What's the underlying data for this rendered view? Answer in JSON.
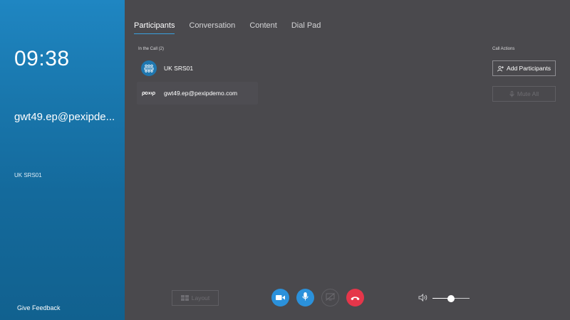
{
  "sidebar": {
    "time": "09:38",
    "remote_name": "gwt49.ep@pexipde...",
    "conference": "UK SRS01",
    "feedback_label": "Give Feedback"
  },
  "tabs": [
    {
      "label": "Participants",
      "active": true
    },
    {
      "label": "Conversation",
      "active": false
    },
    {
      "label": "Content",
      "active": false
    },
    {
      "label": "Dial Pad",
      "active": false
    }
  ],
  "participants_section": {
    "label": "In the Call (2)",
    "items": [
      {
        "name": "UK SRS01",
        "icon": "room-icon"
      },
      {
        "name": "gwt49.ep@pexipdemo.com",
        "icon": "pexip-logo-icon"
      }
    ]
  },
  "call_actions": {
    "label": "Call Actions",
    "add_participants": "Add Participants",
    "mute_all": "Mute All"
  },
  "bottom_bar": {
    "layout_label": "Layout",
    "volume_level": 0.5
  },
  "colors": {
    "sidebar": "#1977ad",
    "background": "#4a494d",
    "accent": "#2b91db",
    "hangup": "#e5364a"
  }
}
